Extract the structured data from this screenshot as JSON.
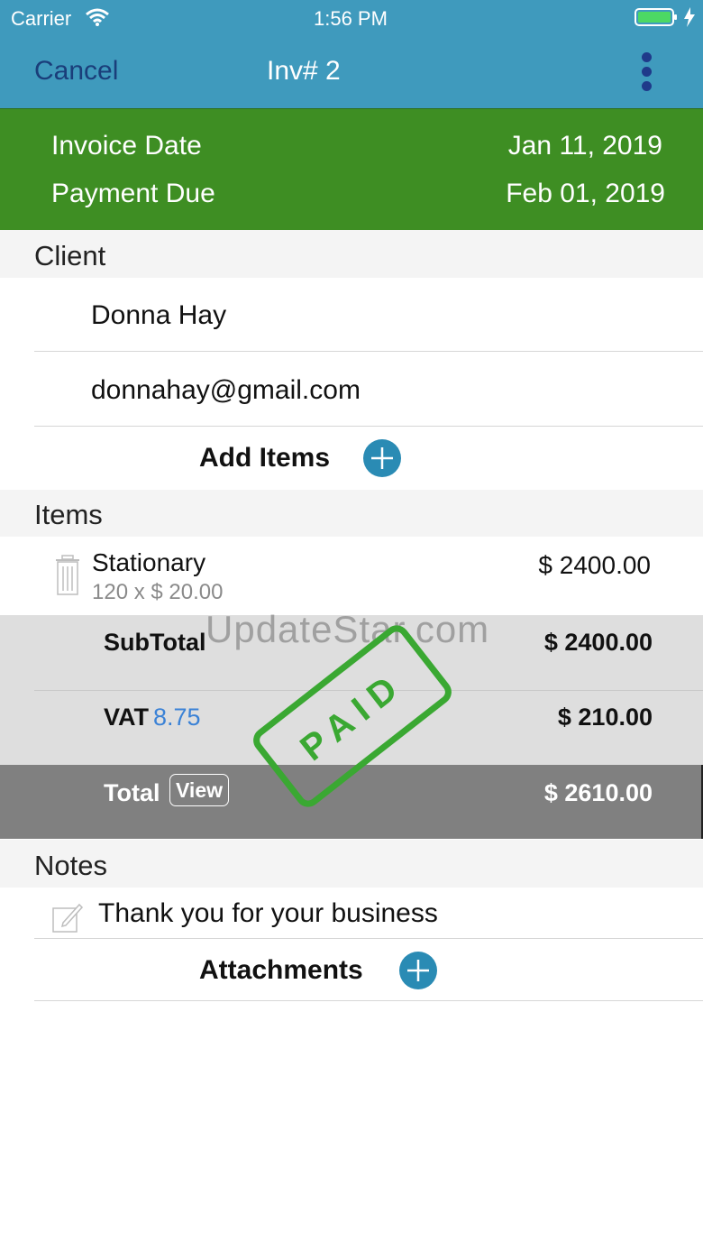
{
  "status_bar": {
    "carrier": "Carrier",
    "time": "1:56 PM"
  },
  "nav": {
    "cancel_label": "Cancel",
    "title": "Inv# 2"
  },
  "dates": {
    "invoice_date_label": "Invoice Date",
    "invoice_date": "Jan 11, 2019",
    "payment_due_label": "Payment Due",
    "payment_due": "Feb 01, 2019"
  },
  "client": {
    "section_title": "Client",
    "name": "Donna Hay",
    "email": "donnahay@gmail.com"
  },
  "add_items_label": "Add Items",
  "items": {
    "section_title": "Items",
    "rows": [
      {
        "name": "Stationary",
        "detail": "120 x $ 20.00",
        "amount": "$ 2400.00"
      }
    ]
  },
  "totals": {
    "subtotal_label": "SubTotal",
    "subtotal": "$ 2400.00",
    "vat_label": "VAT",
    "vat_rate": "8.75",
    "vat": "$ 210.00",
    "total_label": "Total",
    "view_label": "View",
    "total": "$ 2610.00"
  },
  "stamp": {
    "text": "PAID",
    "color": "#3aa832"
  },
  "watermark": "UpdateStar.com",
  "notes": {
    "section_title": "Notes",
    "text": "Thank you for your business"
  },
  "attachments_label": "Attachments",
  "colors": {
    "nav_bg": "#3f9abd",
    "date_bg": "#3e8e23",
    "accent": "#2a8bb4",
    "vat_rate": "#3b82d6"
  }
}
